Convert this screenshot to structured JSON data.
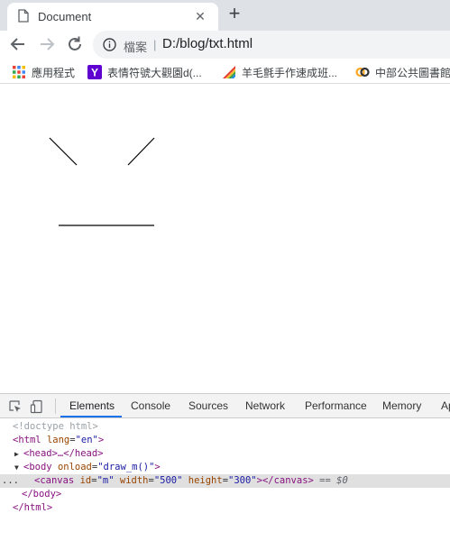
{
  "tab": {
    "title": "Document",
    "close_icon": "close-icon",
    "new_tab_icon": "plus-icon"
  },
  "toolbar": {
    "back_icon": "arrow-left-icon",
    "forward_icon": "arrow-right-icon",
    "reload_icon": "reload-icon",
    "url_scheme_label": "檔案",
    "url_separator": "|",
    "url": "D:/blog/txt.html"
  },
  "bookmarks": [
    {
      "label": "應用程式",
      "icon": "apps-grid-icon"
    },
    {
      "label": "表情符號大觀園d(...",
      "icon": "yahoo-icon"
    },
    {
      "label": "羊毛氈手作速成班...",
      "icon": "rainbow-icon"
    },
    {
      "label": "中部公共圖書館",
      "icon": "chain-icon"
    }
  ],
  "canvas": {
    "id": "m",
    "width": "500",
    "height": "300",
    "stroke_color": "#000000"
  },
  "devtools": {
    "tabs": [
      "Elements",
      "Console",
      "Sources",
      "Network",
      "Performance",
      "Memory",
      "Ap"
    ],
    "active_tab": "Elements",
    "inspect_icon": "cursor-select-icon",
    "device_icon": "device-toggle-icon",
    "accent_color": "#1a73e8",
    "dom": {
      "doctype": "<!doctype html>",
      "html_open_tag": "<html",
      "html_lang_attr": "lang",
      "html_lang_val": "\"en\"",
      "tag_close": ">",
      "head_collapsed": "<head>…</head>",
      "body_open_tag": "<body",
      "body_onload_attr": "onload",
      "body_onload_val": "\"draw_m()\"",
      "canvas_open": "<canvas",
      "canvas_id_attr": "id",
      "canvas_id_val": "\"m\"",
      "canvas_width_attr": "width",
      "canvas_width_val": "\"500\"",
      "canvas_height_attr": "height",
      "canvas_height_val": "\"300\"",
      "canvas_close": "></canvas>",
      "selected_ref": "== $0",
      "selected_dots": "...",
      "body_close": "</body>",
      "html_close": "</html>"
    }
  }
}
